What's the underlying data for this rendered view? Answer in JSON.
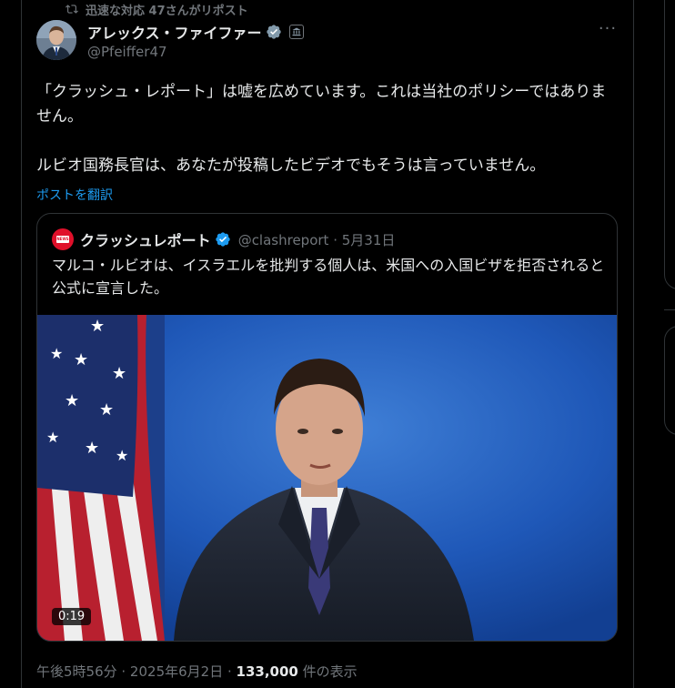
{
  "repost": {
    "icon": "repost-icon",
    "text": "迅速な対応 47さんがリポスト"
  },
  "author": {
    "display_name": "アレックス・ファイファー",
    "handle": "@Pfeiffer47",
    "verified_icon": "verified-badge-icon",
    "gov_icon": "government-badge-icon"
  },
  "more": {
    "label": "···"
  },
  "tweet": {
    "line1": "「クラッシュ・レポート」は嘘を広めています。これは当社のポリシーではありません。",
    "line2": "ルビオ国務長官は、あなたが投稿したビデオでもそうは言っていません。",
    "translate": "ポストを翻訳"
  },
  "quote": {
    "name": "クラッシュレポート",
    "handle": "@clashreport · 5月31日",
    "text": "マルコ・ルビオは、イスラエルを批判する個人は、米国への入国ビザを拒否されると公式に宣言した。",
    "video_duration": "0:19",
    "accent_color": "#e0102a"
  },
  "meta": {
    "time": "午後5時56分 · 2025年6月2日 · ",
    "views_count": "133,000",
    "views_suffix": " 件の表示"
  },
  "colors": {
    "background": "#000000",
    "text": "#e7e9ea",
    "muted": "#71767b",
    "link": "#1d9bf0",
    "border": "#2f3336",
    "verified": "#1d9bf0"
  }
}
